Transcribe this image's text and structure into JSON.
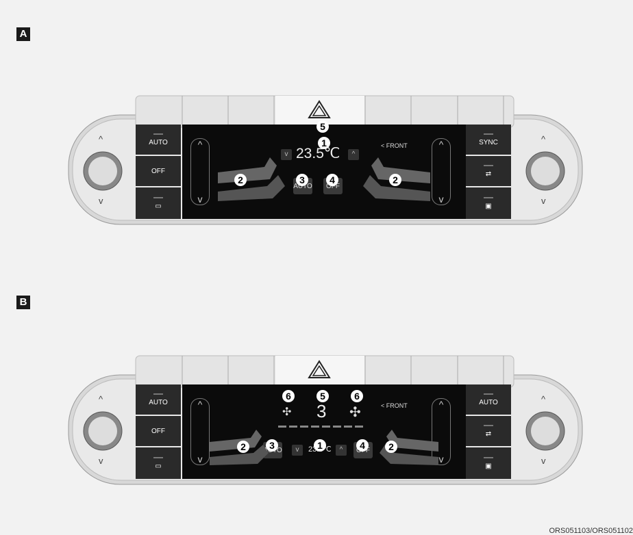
{
  "sections": {
    "a": "A",
    "b": "B"
  },
  "panelA": {
    "buttons_left": [
      "AUTO",
      "OFF"
    ],
    "buttons_right": [
      "SYNC"
    ],
    "front": "< FRONT",
    "temp": "23.5℃",
    "auto": "AUTO",
    "off": "OFF",
    "callouts": {
      "temp": "1",
      "seat_left": "2",
      "seat_right": "2",
      "auto": "3",
      "off": "4",
      "hazard": "5"
    }
  },
  "panelB": {
    "buttons_left": [
      "AUTO",
      "OFF"
    ],
    "buttons_right": [
      "AUTO"
    ],
    "front": "< FRONT",
    "fan_level": "3",
    "temp": "23.5℃",
    "auto": "AUTO",
    "off": "OFF",
    "callouts": {
      "fan_left": "6",
      "fan_level": "5",
      "fan_right": "6",
      "seat_left": "2",
      "auto": "3",
      "temp": "1",
      "off": "4",
      "seat_right": "2"
    }
  },
  "footer": "ORS051103/ORS051102"
}
